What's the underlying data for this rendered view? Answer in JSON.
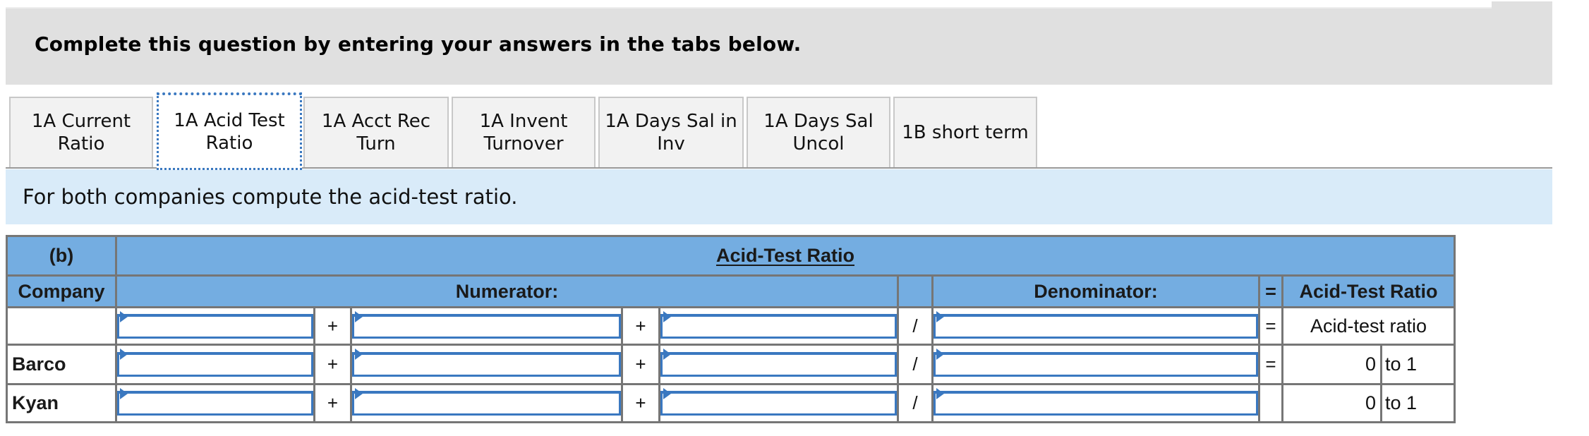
{
  "banner": {
    "text": "Complete this question by entering your answers in the tabs below."
  },
  "tabs": [
    {
      "label_line1": "1A Current",
      "label_line2": "Ratio",
      "active": false
    },
    {
      "label_line1": "1A Acid Test",
      "label_line2": "Ratio",
      "active": true
    },
    {
      "label_line1": "1A Acct Rec",
      "label_line2": "Turn",
      "active": false
    },
    {
      "label_line1": "1A Invent",
      "label_line2": "Turnover",
      "active": false
    },
    {
      "label_line1": "1A Days Sal in",
      "label_line2": "Inv",
      "active": false
    },
    {
      "label_line1": "1A Days Sal",
      "label_line2": "Uncol",
      "active": false
    },
    {
      "label_line1": "1B short term",
      "label_line2": "",
      "active": false
    }
  ],
  "instruction": "For both companies compute the acid-test ratio.",
  "table": {
    "part_label": "(b)",
    "title": "Acid-Test Ratio",
    "company_header": "Company",
    "numerator_header": "Numerator:",
    "denominator_header": "Denominator:",
    "equals_header": "=",
    "result_header": "Acid-Test Ratio",
    "operators": {
      "plus": "+",
      "divide": "/",
      "equals": "="
    },
    "label_row": {
      "company": "",
      "inputs": [
        "",
        "",
        "",
        ""
      ],
      "result_label": "Acid-test ratio"
    },
    "rows": [
      {
        "company": "Barco",
        "inputs": [
          "",
          "",
          "",
          ""
        ],
        "show_equals": true,
        "result_value": "0",
        "result_unit": "to 1"
      },
      {
        "company": "Kyan",
        "inputs": [
          "",
          "",
          "",
          ""
        ],
        "show_equals": false,
        "result_value": "0",
        "result_unit": "to 1"
      }
    ]
  },
  "colors": {
    "header_blue": "#74ade1",
    "instruction_bg": "#d9ebf9",
    "banner_bg": "#e0e0e0",
    "input_border": "#3a78c0"
  }
}
